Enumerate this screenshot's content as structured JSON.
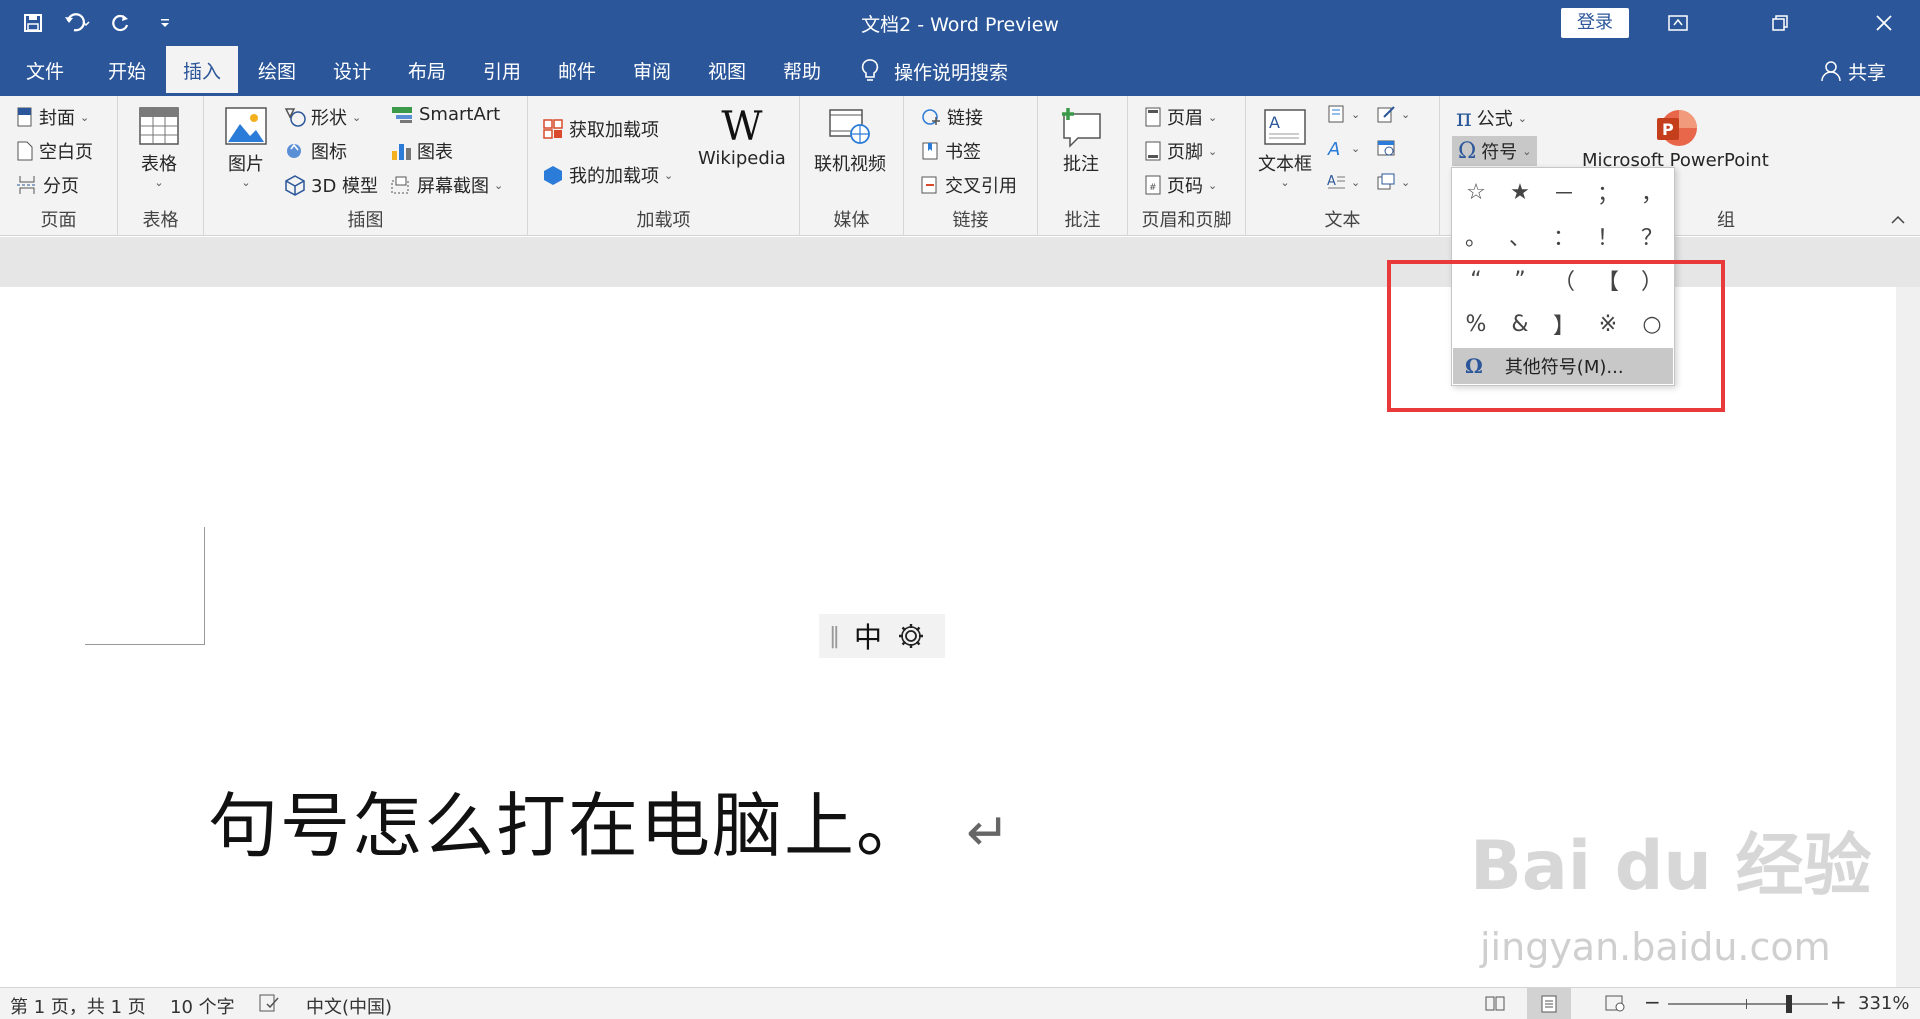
{
  "titlebar": {
    "title": "文档2  -  Word Preview",
    "login": "登录"
  },
  "menu": {
    "tabs": [
      "文件",
      "开始",
      "插入",
      "绘图",
      "设计",
      "布局",
      "引用",
      "邮件",
      "审阅",
      "视图",
      "帮助"
    ],
    "active": "插入",
    "tellme": "操作说明搜索",
    "share": "共享"
  },
  "ribbon": {
    "pages": {
      "label": "页面",
      "cover": "封面",
      "blank": "空白页",
      "break": "分页"
    },
    "tables": {
      "label": "表格",
      "table": "表格"
    },
    "illustrations": {
      "label": "插图",
      "pictures": "图片",
      "shapes": "形状",
      "icons": "图标",
      "model3d": "3D 模型",
      "smartart": "SmartArt",
      "chart": "图表",
      "screenshot": "屏幕截图"
    },
    "addins": {
      "label": "加载项",
      "get": "获取加载项",
      "mine": "我的加载项",
      "wikipedia": "Wikipedia"
    },
    "media": {
      "label": "媒体",
      "video": "联机视频"
    },
    "links": {
      "label": "链接",
      "link": "链接",
      "bookmark": "书签",
      "xref": "交叉引用"
    },
    "comments": {
      "label": "批注",
      "comment": "批注"
    },
    "headerfooter": {
      "label": "页眉和页脚",
      "header": "页眉",
      "footer": "页脚",
      "pagenum": "页码"
    },
    "text": {
      "label": "文本",
      "textbox": "文本框"
    },
    "symbols": {
      "equation": "公式",
      "symbol": "符号"
    },
    "ppt": {
      "name": "Microsoft PowerPoint",
      "label": "组"
    }
  },
  "symbol_dropdown": {
    "symbols": [
      "☆",
      "★",
      "－",
      "；",
      "，",
      "。",
      "、",
      "：",
      "！",
      "？",
      "“",
      "”",
      "（",
      "【",
      "）",
      "%",
      "&",
      "】",
      "※",
      "○"
    ],
    "more": "其他符号(M)..."
  },
  "ime": {
    "mode": "中"
  },
  "document": {
    "text": "句号怎么打在电脑上。",
    "para_mark": "↵"
  },
  "status": {
    "page": "第 1 页，共 1 页",
    "words": "10 个字",
    "lang": "中文(中国)",
    "zoom": "331%"
  },
  "watermark": {
    "brand": "Bai du 经验",
    "url": "jingyan.baidu.com"
  },
  "colors": {
    "accent": "#2b579a",
    "highlight": "#e83a3a"
  }
}
